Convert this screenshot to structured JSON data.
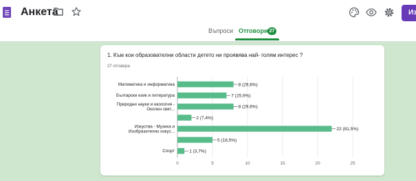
{
  "header": {
    "title": "Анкета",
    "send_label": "Из",
    "icons": {
      "app": "forms-icon",
      "folder": "folder-icon",
      "star": "star-icon",
      "palette": "palette-icon",
      "preview": "eye-icon",
      "settings": "gear-icon"
    },
    "colors": {
      "accent": "#673ab7",
      "active_tab": "#1e8e3e"
    }
  },
  "tabs": {
    "questions": "Въпроси",
    "responses": "Отговори",
    "responses_count": "27"
  },
  "question": {
    "title": "1. Към кои образователни области детето ни проявява най- голям интерес ?",
    "responses": "27 отговора"
  },
  "chart_data": {
    "type": "bar",
    "orientation": "horizontal",
    "categories": [
      "Математика и информатика",
      "Български език и литература",
      "Природни науки и екология - Околен свят...",
      "",
      "Изкуства - Музика и Изобразително изкус...",
      "",
      "Спорт"
    ],
    "values": [
      8,
      7,
      8,
      2,
      22,
      5,
      1
    ],
    "value_labels": [
      "8 (29,6%)",
      "7 (25,9%)",
      "8 (29,6%)",
      "2 (7,4%)",
      "22 (81,5%)",
      "5 (18,5%)",
      "1 (3,7%)"
    ],
    "xticks": [
      "0",
      "5",
      "10",
      "15",
      "20",
      "25"
    ],
    "xlim": [
      0,
      25
    ],
    "bar_color": "#57bb8a"
  }
}
